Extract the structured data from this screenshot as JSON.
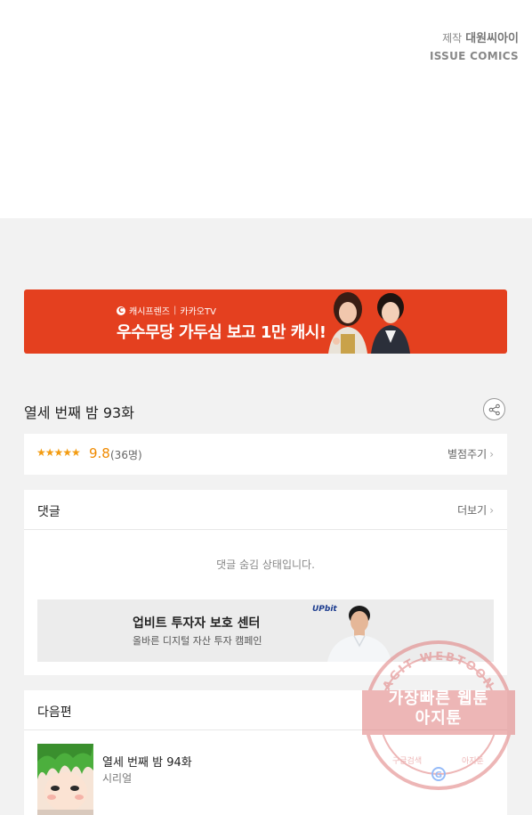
{
  "credit": {
    "label": "제작",
    "studio": "대원씨아이",
    "publisher": "ISSUE COMICS"
  },
  "ad_banner": {
    "brand_left": "캐시프렌즈",
    "brand_right": "카카오TV",
    "headline": "우수무당 가두심 보고 1만 캐시!",
    "bg_color": "#e4401f"
  },
  "episode": {
    "title": "열세 번째 밤 93화"
  },
  "rating": {
    "stars": "★★★★★",
    "score": "9.8",
    "count": "(36명)",
    "rate_label": "별점주기"
  },
  "comments": {
    "title": "댓글",
    "more_label": "더보기",
    "hidden_notice": "댓글 숨김 상태입니다."
  },
  "upbit_ad": {
    "logo": "UPbit",
    "title": "업비트 투자자 보호 센터",
    "subtitle": "올바른 디지털 자산 투자 캠페인"
  },
  "next_episode": {
    "section_title": "다음편",
    "title": "열세 번째 밤 94화",
    "type": "시리얼"
  },
  "watermark": {
    "arc_text": "AGIT WEBTOON",
    "line1": "가장빠른 웹툰",
    "line2": "아지툰",
    "bottom_left": "구글검색",
    "bottom_right": "아지툰",
    "google": "G"
  }
}
